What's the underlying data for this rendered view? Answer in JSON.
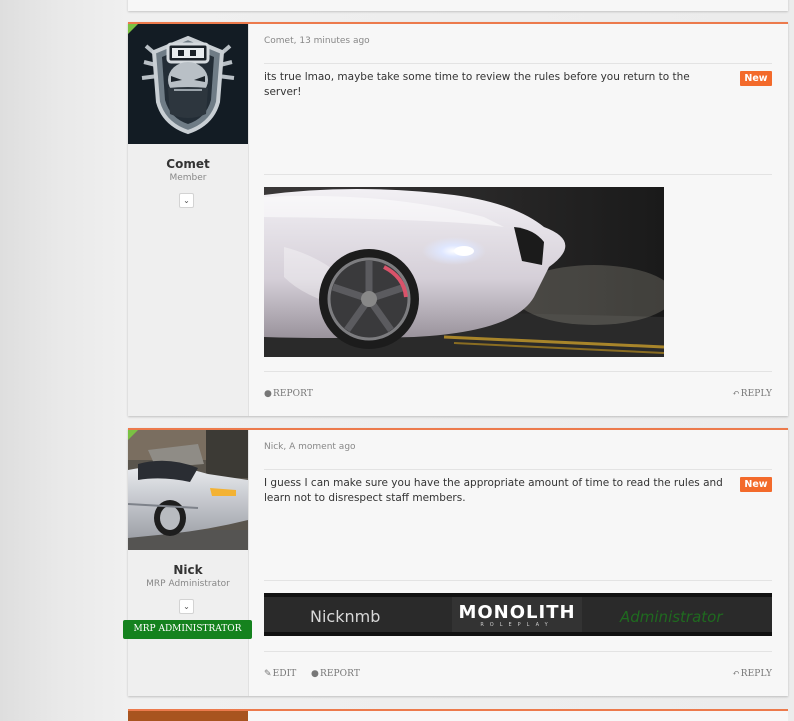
{
  "posts": [
    {
      "author": "Comet",
      "user_title": "Member",
      "meta": "Comet, 13 minutes ago",
      "message": "its true lmao, maybe take some time to review the rules before you return to the server!",
      "badge": "New",
      "actions": {
        "report": "REPORT",
        "reply": "REPLY"
      },
      "avatar_icon": "masked-hacker-shield-logo",
      "attachment_icon": "white-bmw-headlight-image"
    },
    {
      "author": "Nick",
      "user_title": "MRP Administrator",
      "role_badge": "MRP ADMINISTRATOR",
      "meta": "Nick, A moment ago",
      "message": "I guess I can make sure you have the appropriate amount of time to read the rules and learn not to disrespect staff members.",
      "badge": "New",
      "signature": {
        "name": "Nicknmb",
        "logo": "MONOLITH",
        "logo_sub": "ROLEPLAY",
        "role": "Administrator"
      },
      "actions": {
        "edit": "EDIT",
        "report": "REPORT",
        "reply": "REPLY"
      },
      "avatar_icon": "silver-mustang-photo"
    }
  ],
  "colors": {
    "accent_orange": "#ec7a4c",
    "new_badge": "#f36a2b",
    "admin_green": "#15821e",
    "signature_green": "#2b9a2b"
  }
}
